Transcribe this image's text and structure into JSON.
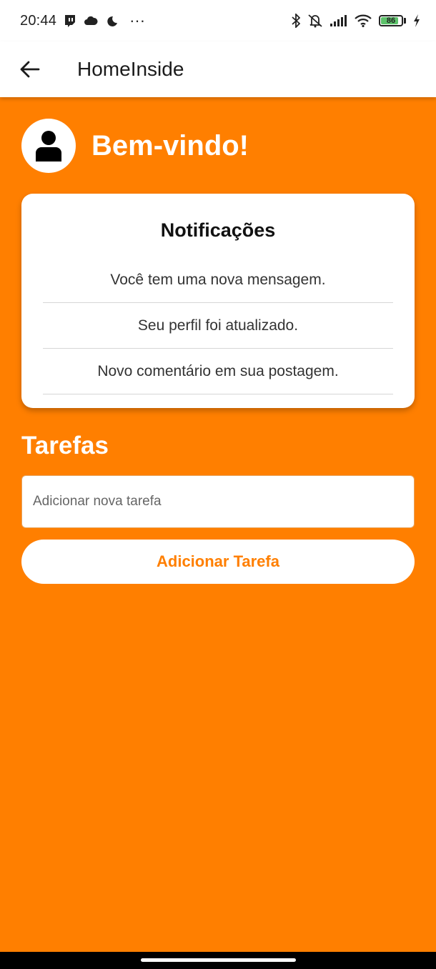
{
  "status_bar": {
    "time": "20:44",
    "left_icons": [
      "twitch-icon",
      "cloud-icon",
      "moon-icon",
      "more-dots-icon"
    ],
    "more_dots": "···",
    "right_icons": [
      "bluetooth-icon",
      "mute-vibrate-icon",
      "signal-icon",
      "wifi-icon",
      "battery-icon",
      "charging-icon"
    ],
    "battery_level": "86"
  },
  "app_bar": {
    "title": "HomeInside",
    "back_icon": "arrow-left-icon"
  },
  "welcome": {
    "avatar_icon": "person-icon",
    "title": "Bem-vindo!"
  },
  "notifications": {
    "title": "Notificações",
    "items": [
      "Você tem uma nova mensagem.",
      "Seu perfil foi atualizado.",
      "Novo comentário em sua postagem."
    ]
  },
  "tasks": {
    "title": "Tarefas",
    "input_placeholder": "Adicionar nova tarefa",
    "input_value": "",
    "add_button_label": "Adicionar Tarefa"
  },
  "colors": {
    "background": "#FF7F00",
    "card": "#FFFFFF",
    "accent_text": "#FF7F00"
  }
}
